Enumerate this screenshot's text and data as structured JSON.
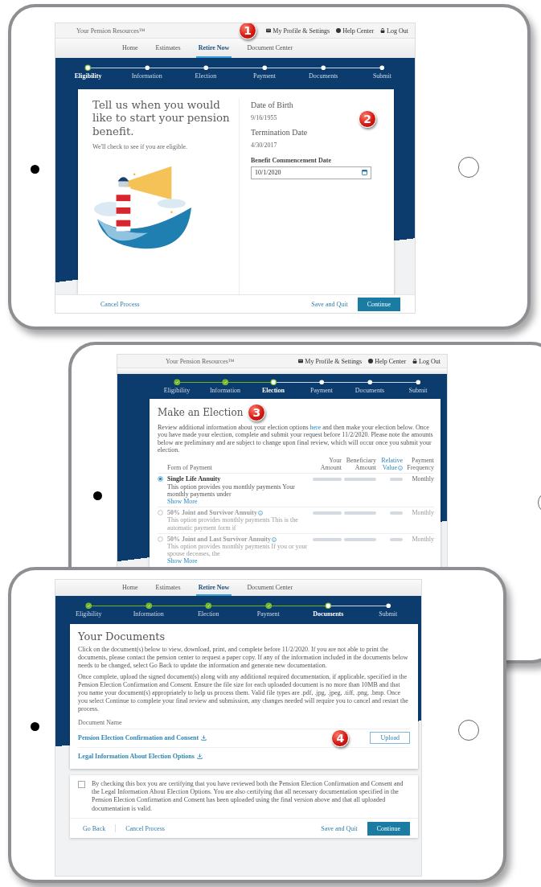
{
  "tablets": [
    {
      "kind": "eligibility",
      "header": {
        "brand": "Your Pension Resources™",
        "badge": "1",
        "links": [
          "My Profile & Settings",
          "Help Center",
          "Log Out"
        ]
      },
      "nav": [
        {
          "label": "Home",
          "selected": false
        },
        {
          "label": "Estimates",
          "selected": false
        },
        {
          "label": "Retire Now",
          "selected": true
        },
        {
          "label": "Document Center",
          "selected": false
        }
      ],
      "steps": [
        {
          "label": "Eligibility",
          "completed": false,
          "selected": true
        },
        {
          "label": "Information",
          "completed": false,
          "selected": false
        },
        {
          "label": "Election",
          "completed": false,
          "selected": false
        },
        {
          "label": "Payment",
          "completed": false,
          "selected": false
        },
        {
          "label": "Documents",
          "completed": false,
          "selected": false
        },
        {
          "label": "Submit",
          "completed": false,
          "selected": false
        }
      ],
      "form": {
        "title": "Tell us when you would like to start your pension benefit.",
        "subtitle": "We'll check to see if you are eligible.",
        "badge": "2",
        "fields": [
          {
            "label": "Date of Birth",
            "value": "9/16/1955"
          },
          {
            "label": "Termination Date",
            "value": "4/30/2017"
          }
        ],
        "input": {
          "label": "Benefit Commencement Date",
          "value": "10/1/2020"
        }
      },
      "footer": {
        "links": [
          "Cancel Process"
        ],
        "secondary": "Save and Quit",
        "primary": "Continue"
      }
    },
    {
      "kind": "election",
      "header": {
        "brand": "Your Pension Resources™",
        "links": [
          "My Profile & Settings",
          "Help Center",
          "Log Out"
        ]
      },
      "steps": [
        {
          "label": "Eligibility",
          "completed": true,
          "selected": false
        },
        {
          "label": "Information",
          "completed": true,
          "selected": false
        },
        {
          "label": "Election",
          "completed": false,
          "selected": true
        },
        {
          "label": "Payment",
          "completed": false,
          "selected": false
        },
        {
          "label": "Documents",
          "completed": false,
          "selected": false
        },
        {
          "label": "Submit",
          "completed": false,
          "selected": false
        }
      ],
      "election": {
        "title": "Make an Election",
        "badge": "3",
        "intro": {
          "before": "Review additional information about your election options",
          "link": "here",
          "after": "and then make your election below. Once you have made your election, complete and submit your request before 11/2/2020. Please note the amounts below are preliminary and are subject to change upon final review, which will occur once you submit your election."
        },
        "columns": [
          {
            "label": "Form of Payment",
            "info": false
          },
          {
            "label": "Your Amount",
            "info": false
          },
          {
            "label": "Beneficiary Amount",
            "info": false
          },
          {
            "label": "Relative Value",
            "info": true
          },
          {
            "label": "Payment Frequency",
            "info": false
          }
        ],
        "rows": [
          {
            "title": "Single Life Annuity",
            "info": false,
            "description": "This option provides you monthly payments Your monthly payments under",
            "show_more": "Show More",
            "frequency": "Monthly",
            "selected": true
          },
          {
            "title": "50% Joint and Survivor Annuity",
            "info": true,
            "description": "This option provides monthly payments This is the automatic payment form if",
            "frequency": "Monthly",
            "selected": false
          },
          {
            "title": "50% Joint and Last Survivor Annuity",
            "info": true,
            "description": "This option provides monthly payments If you or your spouse deceases, the",
            "show_more": "Show More",
            "frequency": "Monthly",
            "selected": false
          }
        ]
      }
    },
    {
      "kind": "documents",
      "nav": [
        {
          "label": "Home",
          "selected": false
        },
        {
          "label": "Estimates",
          "selected": false
        },
        {
          "label": "Retire Now",
          "selected": true
        },
        {
          "label": "Document Center",
          "selected": false
        }
      ],
      "steps": [
        {
          "label": "Eligibility",
          "completed": true,
          "selected": false
        },
        {
          "label": "Information",
          "completed": true,
          "selected": false
        },
        {
          "label": "Election",
          "completed": true,
          "selected": false
        },
        {
          "label": "Payment",
          "completed": true,
          "selected": false
        },
        {
          "label": "Documents",
          "completed": false,
          "selected": true
        },
        {
          "label": "Submit",
          "completed": false,
          "selected": false
        }
      ],
      "documents": {
        "title": "Your Documents",
        "paragraphs": [
          "Click on the document(s) below to view, download, print, and complete before 11/2/2020. If you are not able to print the documents, please contact the pension center to request a paper copy. If any of the information included in the documents below needs to be changed, select Go Back to update the information and generate new documentation.",
          "Once complete, upload the signed document(s) along with any additional required documentation, if applicable, specified in the Pension Election Confirmation and Consent. Ensure the file size for each uploaded document is no more than 10MB and that you name your document(s) appropriately to help us process them. Valid file types are .pdf, .jpg, .jpeg, .tiff, .png, .bmp. Once you select Continue to complete your final review and submission, any changes needed will require you to cancel and restart the process."
        ],
        "column": "Document Name",
        "rows": [
          {
            "name": "Pension Election Confirmation and Consent",
            "badge": "4",
            "upload": "Upload"
          },
          {
            "name": "Legal Information About Election Options"
          }
        ]
      },
      "certification": {
        "checked": false,
        "text": "By checking this box you are certifying that you have reviewed both the Pension Election Confirmation and Consent and the Legal Information About Election Options. You are also certifying that all necessary documentation specified in the Pension Election Confirmation and Consent has been uploaded using the final version above and that all uploaded documentation is valid."
      },
      "footer": {
        "links": [
          "Go Back",
          "Cancel Process"
        ],
        "secondary": "Save and Quit",
        "primary": "Continue"
      }
    }
  ]
}
